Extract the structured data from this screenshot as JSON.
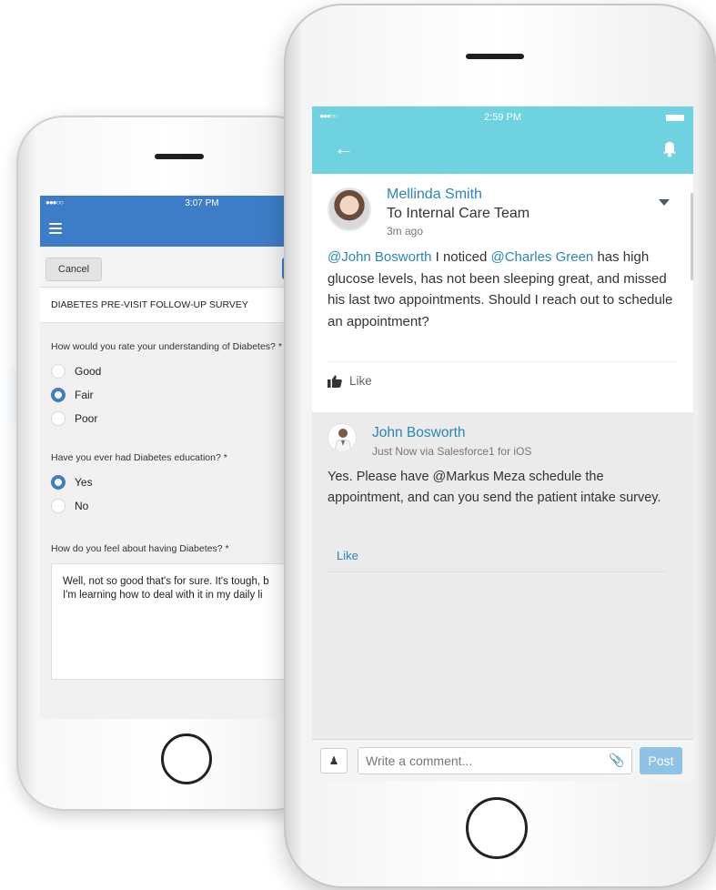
{
  "back_phone": {
    "status_time": "3:07 PM",
    "signal": "●●●○○",
    "cancel_label": "Cancel",
    "survey_title": "DIABETES PRE-VISIT FOLLOW-UP SURVEY",
    "questions": [
      {
        "label": "How would you rate your understanding of Diabetes? *",
        "options": [
          "Good",
          "Fair",
          "Poor"
        ],
        "selected": "Fair"
      },
      {
        "label": "Have you ever had Diabetes education? *",
        "options": [
          "Yes",
          "No"
        ],
        "selected": "Yes"
      }
    ],
    "free_text_question": "How do you feel about having Diabetes? *",
    "free_text_answer": "Well, not so good that's for sure. It's tough, b\nI'm learning how to deal with it in my daily li"
  },
  "front_phone": {
    "status_time": "2:59 PM",
    "signal": "●●●○○",
    "post": {
      "author": "Mellinda Smith",
      "to": "To Internal Care Team",
      "time": "3m ago",
      "mention1": "@John Bosworth",
      "text1": " I noticed ",
      "mention2": "@Charles Green",
      "text2": " has high glucose levels, has not been sleeping great, and missed his last two appointments. Should I reach out to schedule an appointment?",
      "like_label": "Like"
    },
    "comment": {
      "author": "John Bosworth",
      "time": "Just Now via Salesforce1 for iOS",
      "text": "Yes. Please have @Markus Meza schedule the appointment, and can you send the patient intake survey.",
      "like_label": "Like"
    },
    "composer": {
      "placeholder": "Write a comment...",
      "post_label": "Post"
    }
  },
  "colors": {
    "back_header": "#3d7dc7",
    "front_header": "#6fd2e0",
    "link": "#2a86b5",
    "post_button": "#8fc3e6"
  },
  "icons": [
    "hamburger-icon",
    "back-arrow-icon",
    "bell-icon",
    "chevron-down-icon",
    "thumbs-up-icon",
    "share-person-icon",
    "paperclip-icon"
  ]
}
